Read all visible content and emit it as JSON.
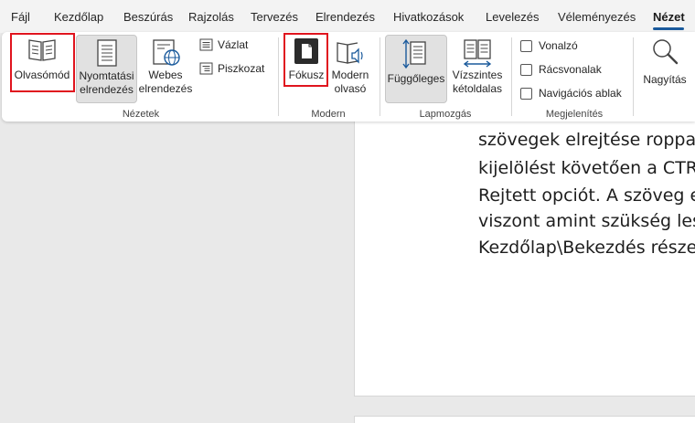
{
  "menu": {
    "tabs": [
      {
        "label": "Fájl"
      },
      {
        "label": "Kezdőlap"
      },
      {
        "label": "Beszúrás"
      },
      {
        "label": "Rajzolás"
      },
      {
        "label": "Tervezés"
      },
      {
        "label": "Elrendezés"
      },
      {
        "label": "Hivatkozások"
      },
      {
        "label": "Levelezés"
      },
      {
        "label": "Véleményezés"
      },
      {
        "label": "Nézet",
        "active": true
      }
    ]
  },
  "ribbon": {
    "views": {
      "group_label": "Nézetek",
      "reading_mode": "Olvasómód",
      "print_layout_l1": "Nyomtatási",
      "print_layout_l2": "elrendezés",
      "web_layout_l1": "Webes",
      "web_layout_l2": "elrendezés",
      "draft": "Vázlat",
      "outline": "Piszkozat"
    },
    "immersive": {
      "group_label": "Modern",
      "focus": "Fókusz",
      "immersive_reader_l1": "Modern",
      "immersive_reader_l2": "olvasó"
    },
    "page_movement": {
      "group_label": "Lapmozgás",
      "vertical": "Függőleges",
      "side_to_side_l1": "Vízszintes",
      "side_to_side_l2": "kétoldalas"
    },
    "show": {
      "group_label": "Megjelenítés",
      "ruler": "Vonalzó",
      "gridlines": "Rácsvonalak",
      "navigation_pane": "Navigációs ablak"
    },
    "zoom": {
      "zoom": "Nagyítás"
    }
  },
  "document": {
    "lines": [
      "szövegek elrejtése roppant",
      "kijelölést követően a CTRL+",
      "Rejtett opciót. A szöveg enn",
      "viszont amint szükség lesz",
      "Kezdőlap\\Bekezdés részen"
    ]
  },
  "colors": {
    "highlight": "#e0141e",
    "accent": "#1a5a9c"
  }
}
